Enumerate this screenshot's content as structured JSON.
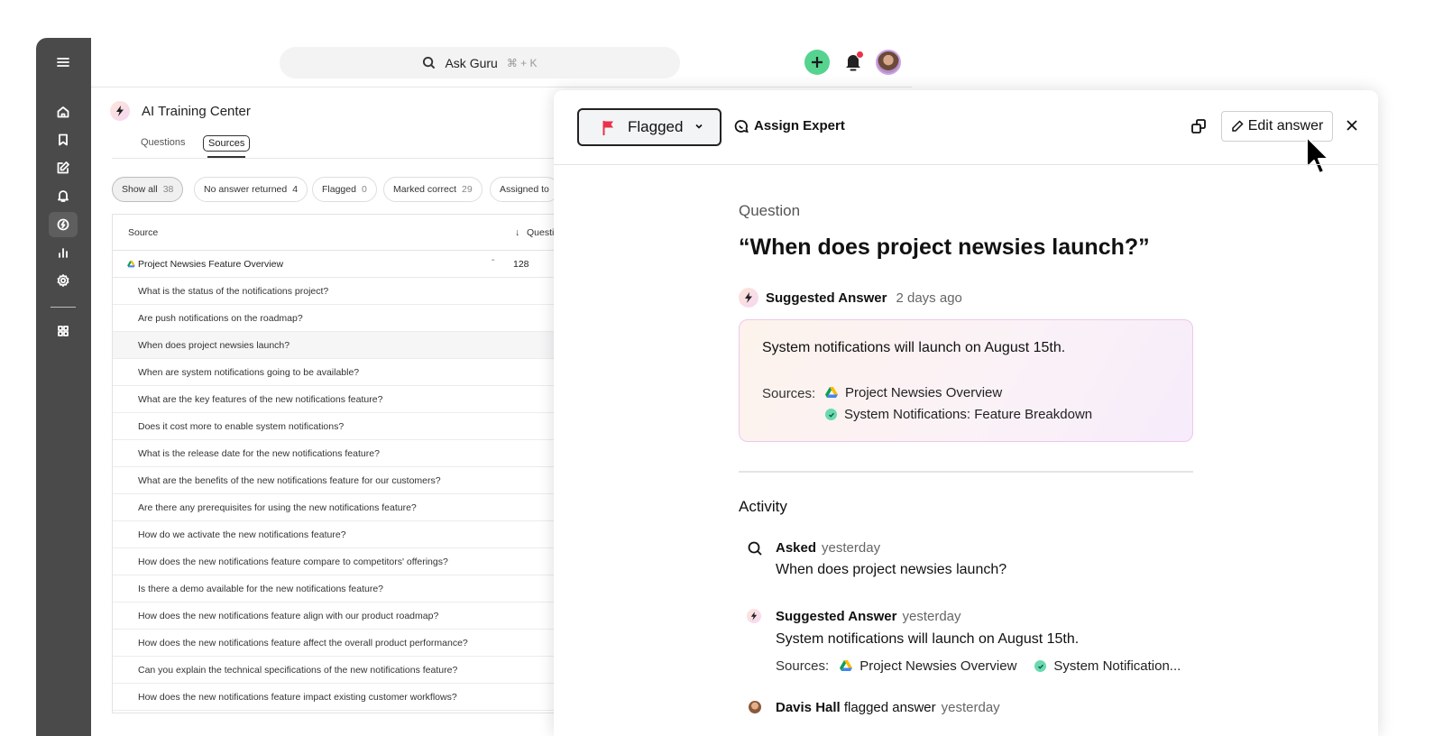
{
  "sidebar": {
    "icons": [
      "menu-icon",
      "home-icon",
      "bookmark-icon",
      "edit-icon",
      "bell-icon",
      "ai-training-icon",
      "analytics-icon",
      "settings-icon",
      "apps-grid-icon"
    ]
  },
  "header": {
    "search_label": "Ask Guru",
    "search_shortcut": "⌘ + K"
  },
  "page": {
    "title": "AI Training Center",
    "tabs": [
      {
        "label": "Questions"
      },
      {
        "label": "Sources"
      }
    ],
    "filters": [
      {
        "label": "Show all",
        "count": "38"
      },
      {
        "label": "No answer returned",
        "count": "4"
      },
      {
        "label": "Flagged",
        "count": "0"
      },
      {
        "label": "Marked correct",
        "count": "29"
      },
      {
        "label": "Assigned to",
        "count": ""
      }
    ],
    "table": {
      "col_source": "Source",
      "col_questions": "Questi",
      "parent": {
        "name": "Project Newsies Feature Overview",
        "count": "128"
      },
      "rows": [
        "What is the status of the notifications project?",
        "Are push notifications on the roadmap?",
        "When does project newsies launch?",
        "When are system notifications going to be available?",
        "What are the key features of the new notifications feature?",
        "Does it cost more to enable system notifications?",
        "What is the release date for the new notifications feature?",
        "What are the benefits of the new notifications feature for our customers?",
        "Are there any prerequisites for using the new notifications feature?",
        "How do we activate the new notifications feature?",
        "How does the new notifications feature compare to competitors' offerings?",
        "Is there a demo available for the new notifications feature?",
        "How does the new notifications feature align with our product roadmap?",
        "How does the new notifications feature affect the overall product performance?",
        "Can you explain the technical specifications of the new notifications feature?",
        "How does the new notifications feature impact existing customer workflows?"
      ]
    }
  },
  "panel": {
    "status_label": "Flagged",
    "assign_label": "Assign Expert",
    "edit_label": "Edit answer",
    "question_heading": "Question",
    "question_text": "“When does project newsies launch?”",
    "suggested_label": "Suggested Answer",
    "suggested_time": "2 days ago",
    "answer_text": "System notifications will launch on August 15th.",
    "sources_label": "Sources:",
    "sources": [
      "Project Newsies Overview",
      "System Notifications: Feature Breakdown"
    ],
    "activity_title": "Activity",
    "activity": {
      "asked_label": "Asked",
      "asked_time": "yesterday",
      "asked_text": "When does project newsies launch?",
      "suggested_label": "Suggested Answer",
      "suggested_time": "yesterday",
      "suggested_text": "System notifications will launch on August 15th.",
      "sources_label": "Sources:",
      "source_1": "Project Newsies Overview",
      "source_2": "System Notification...",
      "flag_user": "Davis Hall",
      "flag_action": "flagged answer",
      "flag_time": "yesterday"
    }
  },
  "colors": {
    "sidebar_bg": "#4a4a4a",
    "add_button": "#55d38f",
    "notification_dot": "#e8334a",
    "flag_red": "#e8334a"
  }
}
